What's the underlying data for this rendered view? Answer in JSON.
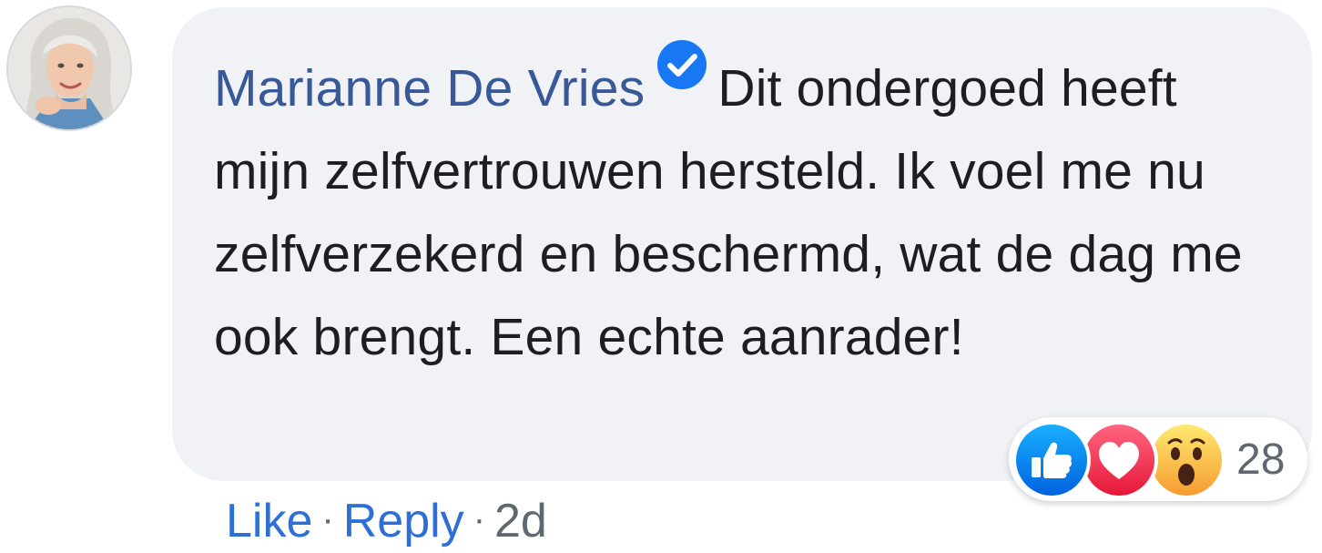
{
  "comment": {
    "author": "Marianne De Vries",
    "verified_icon": "verified-check-badge-icon",
    "text": "Dit ondergoed heeft mijn zelfvertrouwen hersteld. Ik voel me nu zelfverzekerd en beschermd, wat de dag me ook brengt. Een echte aanrader!",
    "avatar_icon": "avatar-photo"
  },
  "actions": {
    "like_label": "Like",
    "separator": "·",
    "reply_label": "Reply",
    "time": "2d"
  },
  "reactions": {
    "icons": [
      "thumbs-up-icon",
      "heart-icon",
      "wow-face-icon"
    ],
    "count": "28"
  },
  "colors": {
    "bubble": "#f0f2f5",
    "author": "#385898",
    "text": "#1c1e21",
    "link": "#2e6fd7",
    "muted": "#606770",
    "like_blue": "#1877f2",
    "love_red": "#f33e58",
    "wow_yellow": "#f7b125"
  }
}
